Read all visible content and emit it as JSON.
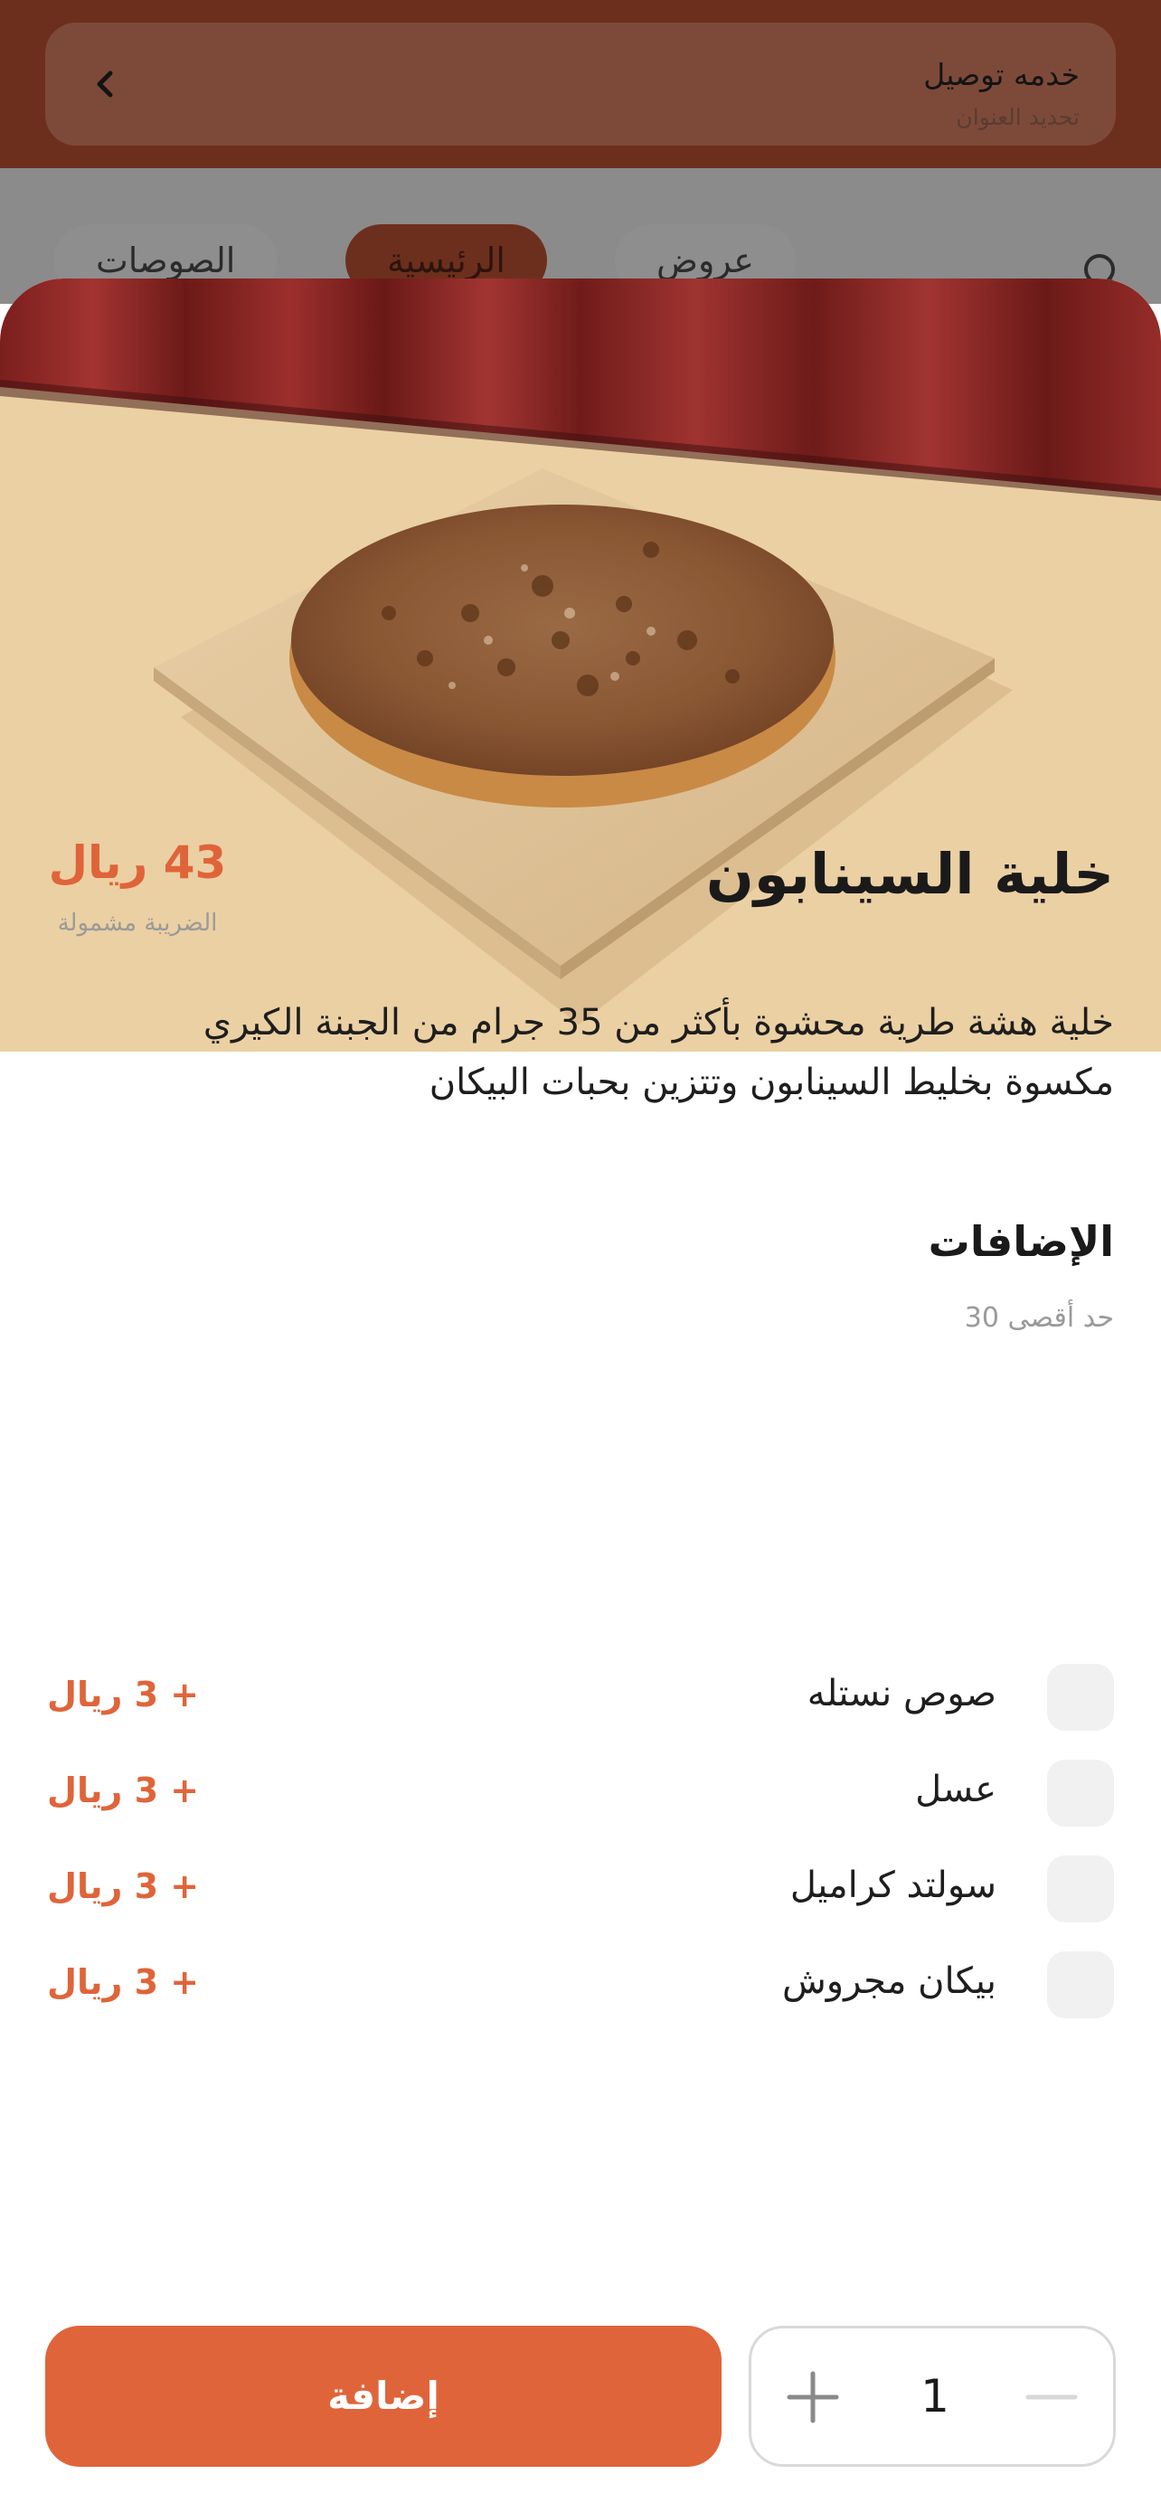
{
  "background": {
    "delivery": {
      "title": "خدمه توصيل",
      "subtitle": "تحديد العنوان"
    },
    "tabs": [
      {
        "label": "الصوصات"
      },
      {
        "label": "الرئيسية",
        "active": true
      },
      {
        "label": "عروض"
      }
    ]
  },
  "product": {
    "name": "خلية السينابون",
    "price": "43 ريال",
    "tax_note": "الضريبة مشمولة",
    "description": "خلية هشة طرية محشوة بأكثر من 35 جرام من الجبنة الكيري مكسوة بخليط السينابون وتتزين بحبات البيكان"
  },
  "addons": {
    "title": "الإضافات",
    "limit": "حد أقصى 30",
    "items": [
      {
        "name": "صوص نستله",
        "price": "+ 3 ريال",
        "checked": false
      },
      {
        "name": "عسل",
        "price": "+ 3 ريال",
        "checked": false
      },
      {
        "name": "سولتد كراميل",
        "price": "+ 3 ريال",
        "checked": false
      },
      {
        "name": "بيكان مجروش",
        "price": "+ 3 ريال",
        "checked": false
      }
    ]
  },
  "cart": {
    "add_label": "إضافة",
    "quantity": "1"
  },
  "colors": {
    "accent": "#e0643a",
    "header": "#6d2f1d",
    "checkbox": "#f1f1f1"
  },
  "icons": {
    "back": "chevron-left-icon",
    "search": "search-icon",
    "plus": "plus-icon",
    "minus": "minus-icon"
  }
}
